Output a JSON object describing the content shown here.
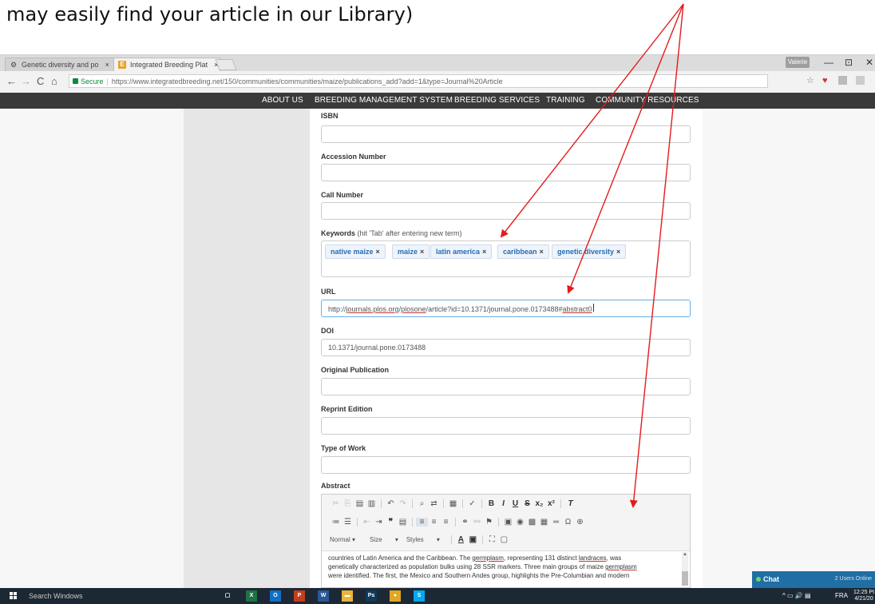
{
  "caption": "may easily find your article in our Library)",
  "browser": {
    "tabs": [
      {
        "title": "Genetic diversity and po",
        "close": "×"
      },
      {
        "title": "Integrated Breeding Plat",
        "close": "×"
      }
    ],
    "user": "Valerie",
    "window_controls": {
      "minimize": "—",
      "restore": "⊡",
      "close": "✕"
    },
    "nav": {
      "back": "←",
      "forward": "→",
      "reload": "C",
      "home": "⌂"
    },
    "secure_label": "Secure",
    "url": "https://www.integratedbreeding.net/150/communities/communities/maize/publications_add?add=1&type=Journal%20Article"
  },
  "sitenav": [
    "ABOUT US",
    "BREEDING MANAGEMENT SYSTEM",
    "BREEDING SERVICES",
    "TRAINING",
    "COMMUNITY RESOURCES"
  ],
  "form": {
    "isbn_label": "ISBN",
    "accession_label": "Accession Number",
    "call_label": "Call Number",
    "keywords_label": "Keywords",
    "keywords_hint": "(hit 'Tab' after entering new term)",
    "keywords": [
      "native maize",
      "maize",
      "latin america",
      "caribbean",
      "genetic diversity"
    ],
    "chip_remove": "×",
    "url_label": "URL",
    "url_parts": {
      "a": "http://",
      "b": "journals.plos.org",
      "c": "/",
      "d": "plosone",
      "e": "/article?id=10.1371/journal.pone.0173488#",
      "f": "abstract0"
    },
    "doi_label": "DOI",
    "doi_value": "10.1371/journal.pone.0173488",
    "original_label": "Original Publication",
    "reprint_label": "Reprint Edition",
    "work_label": "Type of Work",
    "abstract_label": "Abstract"
  },
  "editor": {
    "format_combo": "Normal",
    "size_combo": "Size",
    "styles_combo": "Styles",
    "combo_arrow": "▾",
    "body": {
      "l1a": "countries of Latin America and the Caribbean. The ",
      "l1b": "germplasm",
      "l1c": ", representing 131 distinct ",
      "l1d": "landraces",
      "l1e": ", was",
      "l2": "genetically characterized as population bulks using 28 SSR markers. Three main groups of maize ",
      "l2b": "germplasm",
      "l3": "were identified. The first, the Mexico and Southern Andes group, highlights the Pre-Columbian and modern"
    }
  },
  "chat": {
    "label": "Chat",
    "online": "2 Users Online"
  },
  "taskbar": {
    "search": "Search Windows",
    "apps": [
      {
        "label": "▢",
        "color": "#1c2834"
      },
      {
        "label": "X",
        "color": "#1f7244"
      },
      {
        "label": "O",
        "color": "#0f6fc6"
      },
      {
        "label": "P",
        "color": "#c43e1c"
      },
      {
        "label": "W",
        "color": "#2b5797"
      },
      {
        "label": "▬",
        "color": "#e8b43a"
      },
      {
        "label": "Ps",
        "color": "#0f3a5c"
      },
      {
        "label": "●",
        "color": "#e0a623"
      },
      {
        "label": "S",
        "color": "#00a9f0"
      }
    ],
    "tray_icons": "^ ▭ 🔊 ▤",
    "lang": "FRA",
    "time": "12:25 PI",
    "date": "4/21/20"
  }
}
